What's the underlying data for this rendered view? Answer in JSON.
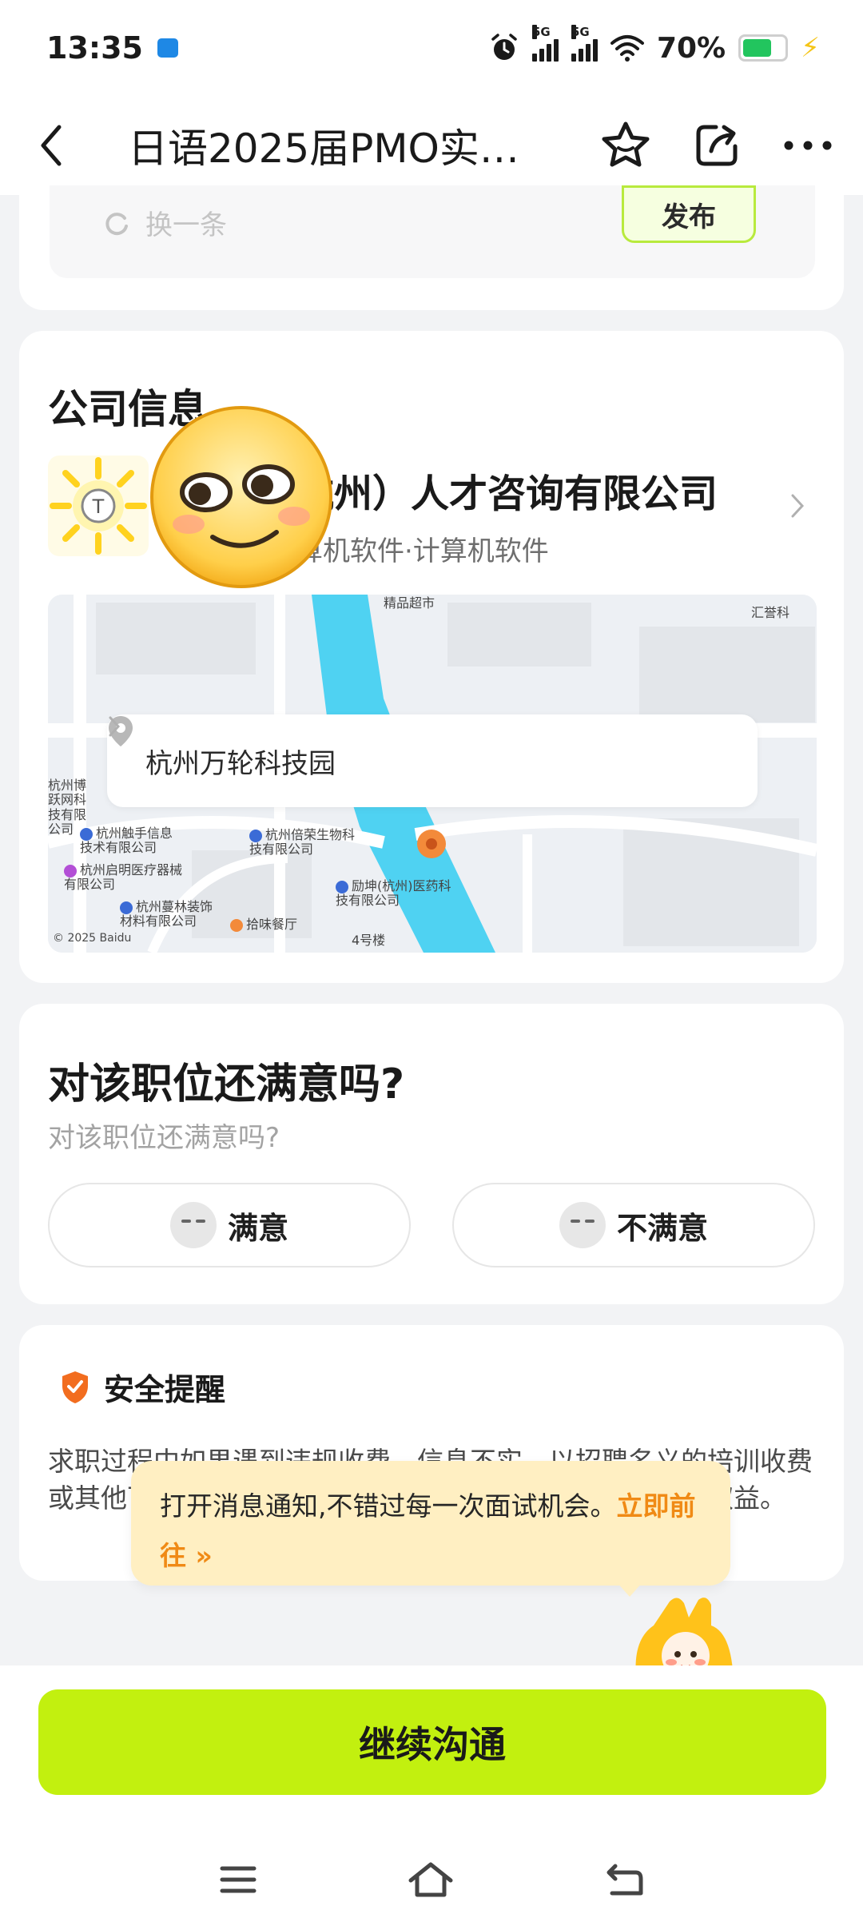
{
  "status_bar": {
    "time": "13:35",
    "network_1": "5G",
    "network_2": "5G",
    "battery": "70%",
    "battery_level": 0.7,
    "battery_color": "#22c55e"
  },
  "header": {
    "title": "日语2025届PMO实…",
    "icons": [
      "back-icon",
      "star-icon",
      "share-icon",
      "more-icon"
    ]
  },
  "top_card": {
    "refresh_label": "换一条",
    "publish_label": "发布"
  },
  "company": {
    "section_title": "公司信息",
    "name": "杭州）人才咨询有限公司",
    "industry": "算机软件·计算机软件",
    "map": {
      "location_label": "杭州万轮科技园",
      "copyright": "© 2025 Baidu",
      "pois": [
        "杭州触手信息技术有限公司",
        "杭州启明医疗器械有限公司",
        "杭州蔓林装饰材料有限公司",
        "杭州倍荣生物科技有限公司",
        "励坤(杭州)医药科技有限公司",
        "杭州博跃网科技有限公司",
        "精品超市",
        "汇誉科",
        "拾味餐厅",
        "4号楼"
      ]
    }
  },
  "satisfaction": {
    "title": "对该职位还满意吗?",
    "subtitle": "对该职位还满意吗?",
    "satisfied_label": "满意",
    "unsatisfied_label": "不满意"
  },
  "safety": {
    "title": "安全提醒",
    "text": "求职过程中如果遇到违规收费、信息不实、以招聘名义的培训收费或其他可疑情况，请立即举报并保留证据，维护自身合法权益。"
  },
  "toast": {
    "message": "打开消息通知,不错过每一次面试机会。",
    "link": "立即前往 »"
  },
  "cta": {
    "label": "继续沟通",
    "color": "#c2f00f"
  },
  "nav": {
    "icons": [
      "menu-icon",
      "home-icon",
      "back-nav-icon"
    ]
  }
}
